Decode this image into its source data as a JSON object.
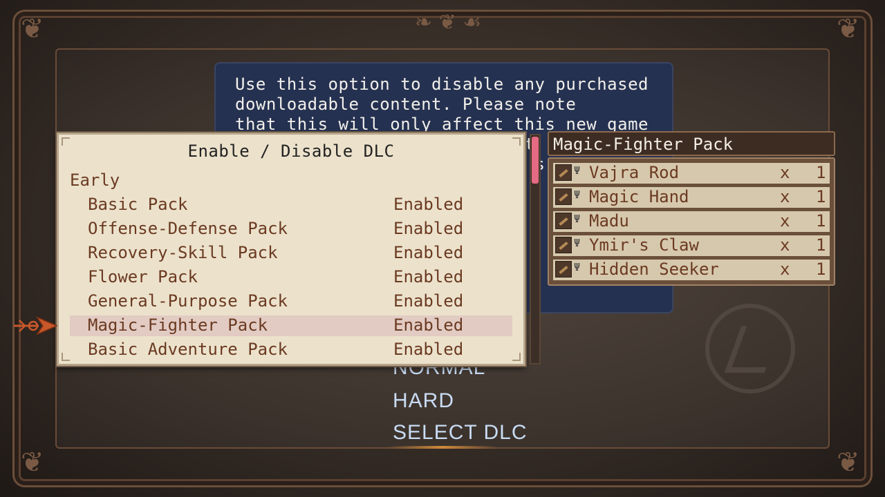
{
  "info": {
    "text": "Use this option to disable any purchased\ndownloadable content. Please note\nthat this will only affect this new game\nand once started you will not\nenable the content until you s\nnew game."
  },
  "difficulty": {
    "normal": "NORMAL",
    "hard": "HARD",
    "select_dlc": "SELECT DLC"
  },
  "dlc_window": {
    "title": "Enable / Disable DLC",
    "section": "Early",
    "packs": [
      {
        "name": "Basic Pack",
        "status": "Enabled"
      },
      {
        "name": "Offense-Defense Pack",
        "status": "Enabled"
      },
      {
        "name": "Recovery-Skill Pack",
        "status": "Enabled"
      },
      {
        "name": "Flower Pack",
        "status": "Enabled"
      },
      {
        "name": "General-Purpose Pack",
        "status": "Enabled"
      },
      {
        "name": "Magic-Fighter Pack",
        "status": "Enabled"
      },
      {
        "name": "Basic Adventure Pack",
        "status": "Enabled"
      }
    ],
    "selected_index": 5
  },
  "item_panel": {
    "title": "Magic-Fighter Pack",
    "items": [
      {
        "name": "Vajra Rod",
        "x": "x",
        "qty": "1",
        "icon": "rod-icon"
      },
      {
        "name": "Magic Hand",
        "x": "x",
        "qty": "1",
        "icon": "gauntlet-icon"
      },
      {
        "name": "Madu",
        "x": "x",
        "qty": "1",
        "icon": "madu-icon"
      },
      {
        "name": "Ymir's Claw",
        "x": "x",
        "qty": "1",
        "icon": "claw-icon"
      },
      {
        "name": "Hidden Seeker",
        "x": "x",
        "qty": "1",
        "icon": "seeker-icon"
      }
    ]
  },
  "colors": {
    "selected_row": "#e2cbc2",
    "scroll_thumb": "#e56a84",
    "cursor": "#c8582a"
  }
}
